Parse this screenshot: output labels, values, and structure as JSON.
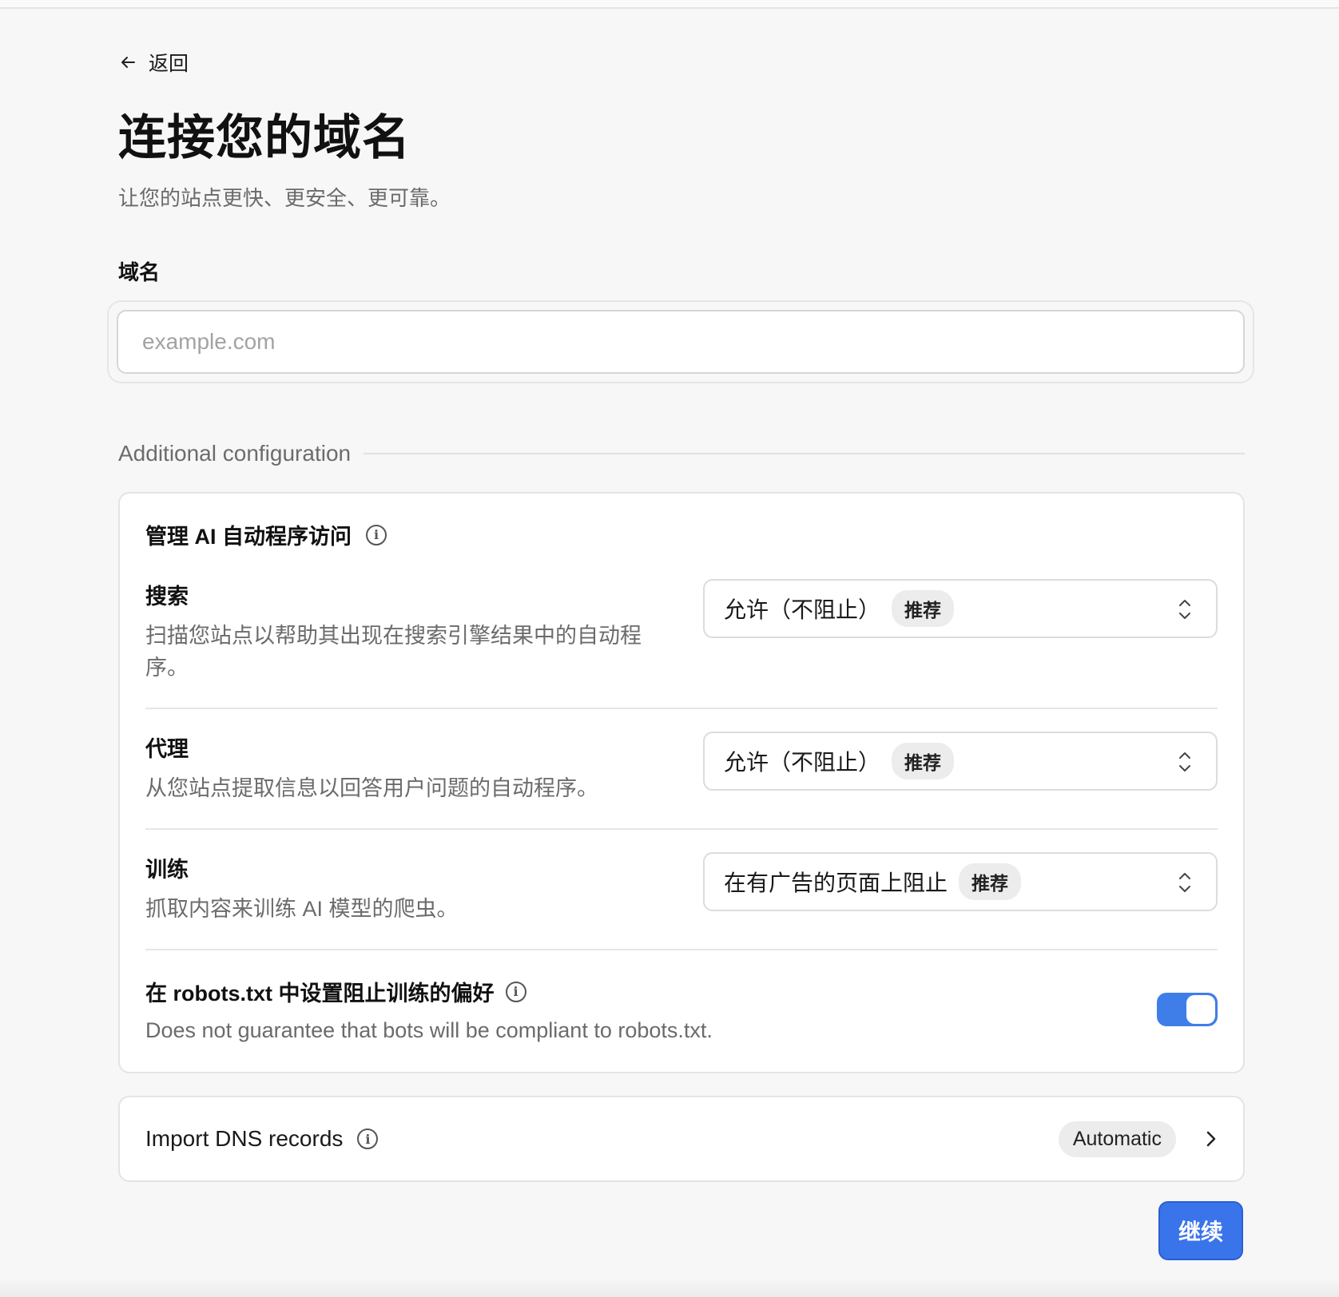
{
  "nav": {
    "back_label": "返回"
  },
  "page": {
    "title": "连接您的域名",
    "subtitle": "让您的站点更快、更安全、更可靠。"
  },
  "domain": {
    "label": "域名",
    "placeholder": "example.com",
    "value": ""
  },
  "additional": {
    "heading": "Additional configuration"
  },
  "ai_access": {
    "title": "管理 AI 自动程序访问",
    "rows": [
      {
        "title": "搜索",
        "desc": "扫描您站点以帮助其出现在搜索引擎结果中的自动程序。",
        "select_value": "允许（不阻止）",
        "badge": "推荐"
      },
      {
        "title": "代理",
        "desc": "从您站点提取信息以回答用户问题的自动程序。",
        "select_value": "允许（不阻止）",
        "badge": "推荐"
      },
      {
        "title": "训练",
        "desc": "抓取内容来训练 AI 模型的爬虫。",
        "select_value": "在有广告的页面上阻止",
        "badge": "推荐"
      }
    ],
    "robots": {
      "title": "在 robots.txt 中设置阻止训练的偏好",
      "desc": "Does not guarantee that bots will be compliant to robots.txt.",
      "enabled": true
    }
  },
  "dns": {
    "title": "Import DNS records",
    "badge": "Automatic"
  },
  "actions": {
    "continue_label": "继续"
  },
  "colors": {
    "accent": "#3a74ea",
    "toggle_on": "#3f7ee8"
  }
}
